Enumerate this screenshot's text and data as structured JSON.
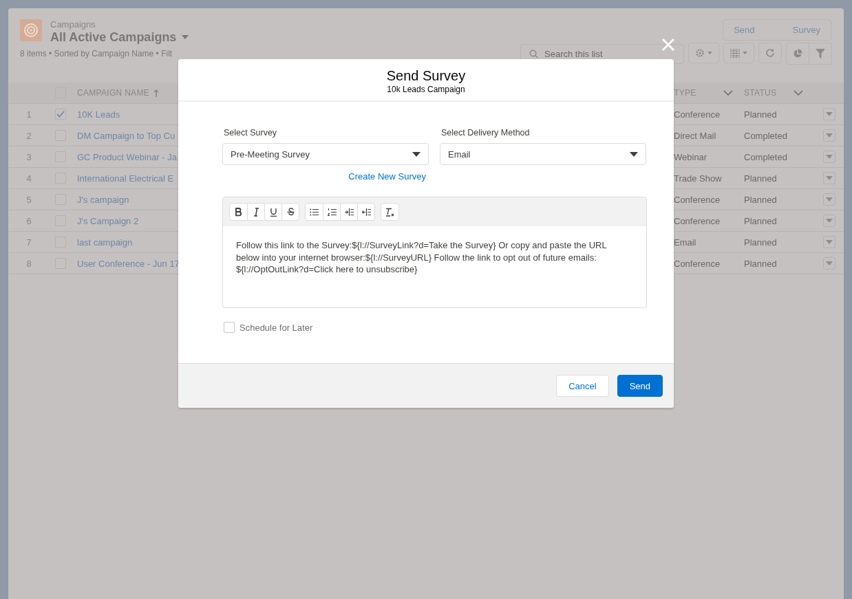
{
  "list_header": {
    "object_label": "Campaigns",
    "view_name": "All Active Campaigns",
    "summary": "8 items • Sorted by Campaign Name • Filt",
    "actions": [
      "Send",
      "Survey"
    ],
    "search": {
      "placeholder": "Search this list"
    }
  },
  "table": {
    "select_all_checked": false,
    "columns": [
      {
        "label": "CAMPAIGN NAME",
        "sorted": true
      },
      {
        "label": "TYPE",
        "sorted": false
      },
      {
        "label": "STATUS",
        "sorted": false
      }
    ],
    "rows": [
      {
        "number": "1",
        "checked": true,
        "name": "10K Leads",
        "type": "Conference",
        "status": "Planned"
      },
      {
        "number": "2",
        "checked": false,
        "name": "DM Campaign to Top Cu",
        "type": "Direct Mail",
        "status": "Completed"
      },
      {
        "number": "3",
        "checked": false,
        "name": "GC Product Webinar - Ja",
        "type": "Webinar",
        "status": "Completed"
      },
      {
        "number": "4",
        "checked": false,
        "name": "International Electrical E",
        "type": "Trade Show",
        "status": "Planned"
      },
      {
        "number": "5",
        "checked": false,
        "name": "J's campaign",
        "type": "Conference",
        "status": "Planned"
      },
      {
        "number": "6",
        "checked": false,
        "name": "J's Campaign 2",
        "type": "Conference",
        "status": "Planned"
      },
      {
        "number": "7",
        "checked": false,
        "name": "last campaign",
        "type": "Email",
        "status": "Planned"
      },
      {
        "number": "8",
        "checked": false,
        "name": "User Conference - Jun 17",
        "type": "Conference",
        "status": "Planned"
      }
    ]
  },
  "modal": {
    "title": "Send Survey",
    "subtitle": "10k Leads Campaign",
    "fields": [
      {
        "label": "Select Survey",
        "value": "Pre-Meeting Survey"
      },
      {
        "label": "Select Delivery Method",
        "value": "Email"
      }
    ],
    "create_link": "Create New Survey",
    "message": "Follow this link to the Survey:${l://SurveyLink?d=Take the Survey} Or copy and paste the URL below into your internet browser:${l://SurveyURL} Follow the link to opt out of future emails: ${l://OptOutLink?d=Click here to unsubscribe}",
    "schedule": {
      "label": "Schedule for Later",
      "checked": false
    },
    "buttons": [
      {
        "label": "Cancel",
        "kind": "neutral"
      },
      {
        "label": "Send",
        "kind": "brand"
      }
    ]
  }
}
